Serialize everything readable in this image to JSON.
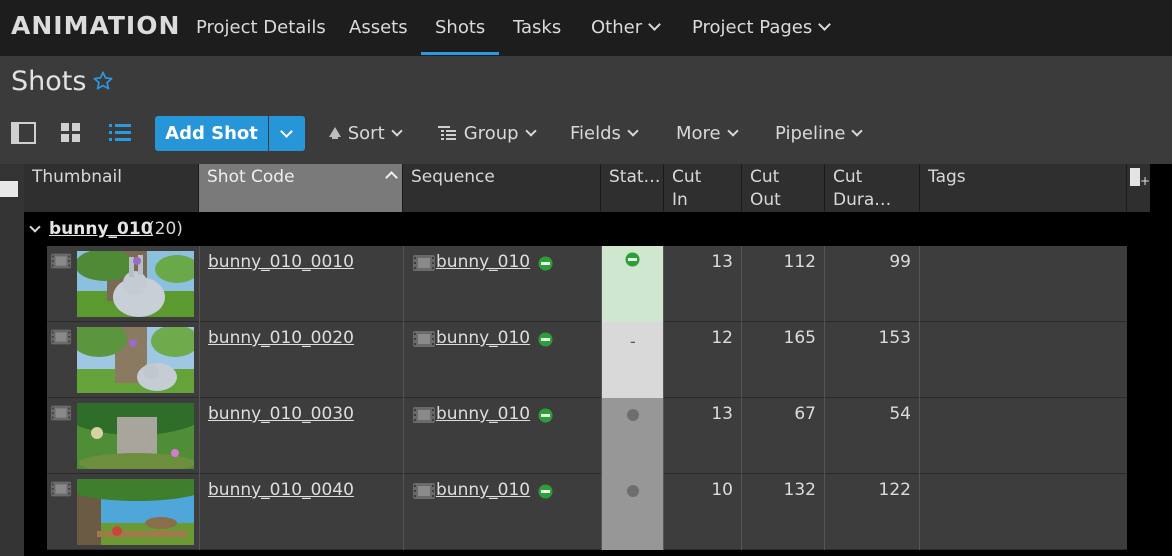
{
  "app": {
    "brand": "ANIMATION"
  },
  "nav": {
    "items": [
      {
        "label": "Project Details",
        "dropdown": false,
        "active": false
      },
      {
        "label": "Assets",
        "dropdown": false,
        "active": false
      },
      {
        "label": "Shots",
        "dropdown": false,
        "active": true
      },
      {
        "label": "Tasks",
        "dropdown": false,
        "active": false
      },
      {
        "label": "Other",
        "dropdown": true,
        "active": false
      },
      {
        "label": "Project Pages",
        "dropdown": true,
        "active": false
      }
    ]
  },
  "page": {
    "title": "Shots",
    "favorite_icon": "star-outline-icon"
  },
  "toolbar": {
    "view_icons": [
      "panel-view-icon",
      "thumbnail-grid-icon",
      "list-view-icon"
    ],
    "add_label": "Add Shot",
    "sort_label": "Sort",
    "group_label": "Group",
    "fields_label": "Fields",
    "more_label": "More",
    "pipeline_label": "Pipeline"
  },
  "columns": {
    "thumbnail": "Thumbnail",
    "shot_code": "Shot Code",
    "sequence": "Sequence",
    "status": "Stat…",
    "cut_in": "Cut In",
    "cut_out": "Cut Out",
    "cut_duration": "Cut Dura…",
    "tags": "Tags"
  },
  "group": {
    "name": "bunny_010",
    "count": "(20)"
  },
  "rows": [
    {
      "shot_code": "bunny_010_0010",
      "sequence": "bunny_010",
      "status": "green",
      "cut_in": "13",
      "cut_out": "112",
      "cut_duration": "99",
      "tags": ""
    },
    {
      "shot_code": "bunny_010_0020",
      "sequence": "bunny_010",
      "status": "na",
      "cut_in": "12",
      "cut_out": "165",
      "cut_duration": "153",
      "tags": ""
    },
    {
      "shot_code": "bunny_010_0030",
      "sequence": "bunny_010",
      "status": "waiting",
      "cut_in": "13",
      "cut_out": "67",
      "cut_duration": "54",
      "tags": ""
    },
    {
      "shot_code": "bunny_010_0040",
      "sequence": "bunny_010",
      "status": "waiting",
      "cut_in": "10",
      "cut_out": "132",
      "cut_duration": "122",
      "tags": ""
    }
  ],
  "colors": {
    "accent": "#2796d9",
    "status_green_bg": "#cfe6cf",
    "status_na_bg": "#d9d9d9",
    "status_wait_bg": "#979797",
    "status_green_dot": "#2e9e3a"
  }
}
